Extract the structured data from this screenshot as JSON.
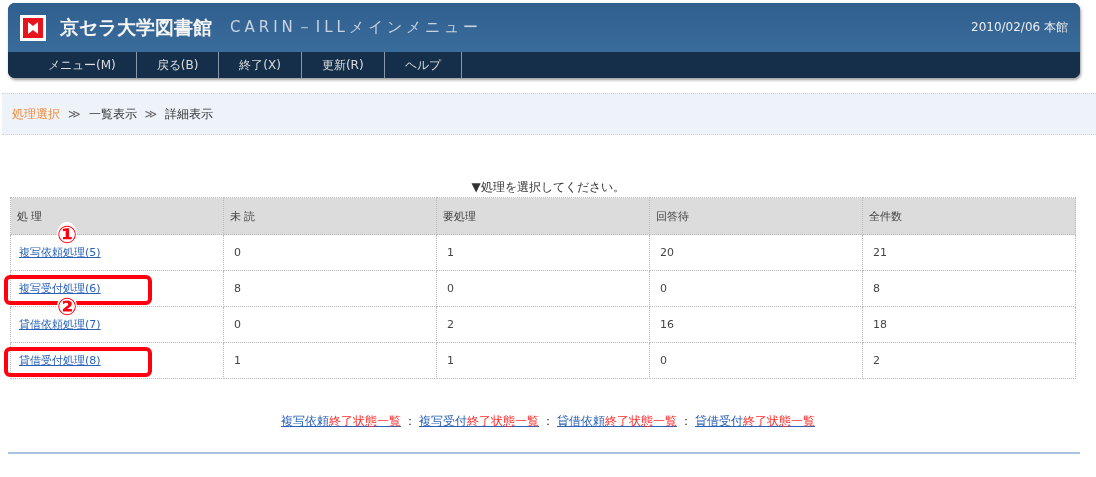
{
  "header": {
    "title": "京セラ大学図書館",
    "subtitle": "CARIN－ILLメインメニュー",
    "date": "2010/02/06 本館"
  },
  "menu": [
    {
      "label": "メニュー(M)"
    },
    {
      "label": "戻る(B)"
    },
    {
      "label": "終了(X)"
    },
    {
      "label": "更新(R)"
    },
    {
      "label": "ヘルプ"
    }
  ],
  "breadcrumb": [
    {
      "label": "処理選択",
      "current": true
    },
    {
      "label": "≫",
      "kind": "sep"
    },
    {
      "label": "一覧表示",
      "current": false
    },
    {
      "label": "≫",
      "kind": "sep"
    },
    {
      "label": "詳細表示",
      "current": false
    }
  ],
  "instruction": "▼処理を選択してください。",
  "table": {
    "columns": [
      "処 理",
      "未 読",
      "要処理",
      "回答待",
      "全件数"
    ],
    "rows": [
      {
        "cells": [
          "複写依頼処理(5)",
          "0",
          "1",
          "20",
          "21"
        ],
        "marker": "①",
        "highlighted": false
      },
      {
        "cells": [
          "複写受付処理(6)",
          "8",
          "0",
          "0",
          "8"
        ],
        "highlighted": true
      },
      {
        "cells": [
          "貸借依頼処理(7)",
          "0",
          "2",
          "16",
          "18"
        ],
        "marker": "②",
        "highlighted": false
      },
      {
        "cells": [
          "貸借受付処理(8)",
          "1",
          "1",
          "0",
          "2"
        ],
        "highlighted": true
      }
    ]
  },
  "footer_links": [
    {
      "kind": "link",
      "prefix": "複写依頼",
      "highlight": "終了状態一覧"
    },
    {
      "kind": "sep",
      "label": "："
    },
    {
      "kind": "link",
      "prefix": "複写受付",
      "highlight": "終了状態一覧"
    },
    {
      "kind": "sep",
      "label": "："
    },
    {
      "kind": "link",
      "prefix": "貸借依頼",
      "highlight": "終了状態一覧"
    },
    {
      "kind": "sep",
      "label": "："
    },
    {
      "kind": "link",
      "prefix": "貸借受付",
      "highlight": "終了状態一覧"
    }
  ]
}
